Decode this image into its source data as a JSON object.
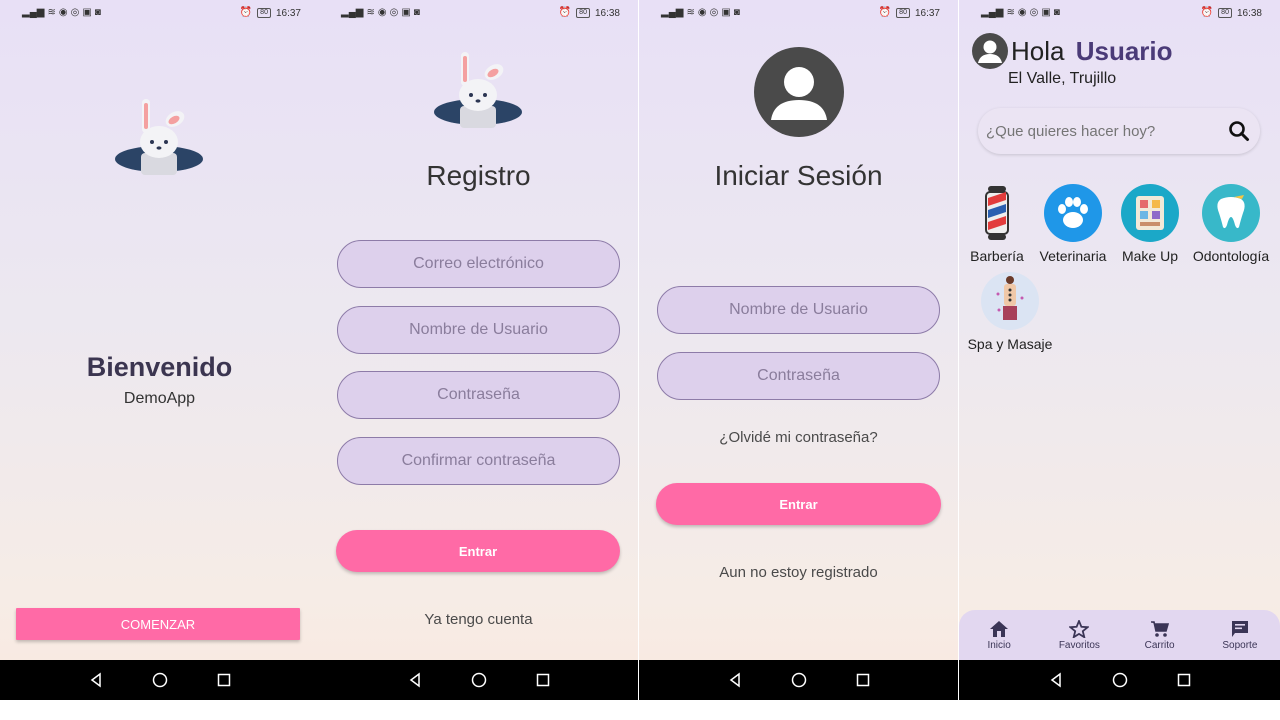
{
  "screens": {
    "welcome": {
      "time": "16:37",
      "battery": "80",
      "title": "Bienvenido",
      "subtitle": "DemoApp",
      "start_button": "COMENZAR"
    },
    "register": {
      "time": "16:38",
      "battery": "80",
      "title": "Registro",
      "email_placeholder": "Correo electrónico",
      "username_placeholder": "Nombre de Usuario",
      "password_placeholder": "Contraseña",
      "confirm_placeholder": "Confirmar contraseña",
      "submit_button": "Entrar",
      "have_account_link": "Ya tengo cuenta"
    },
    "login": {
      "time": "16:37",
      "battery": "80",
      "title": "Iniciar Sesión",
      "username_placeholder": "Nombre de Usuario",
      "password_placeholder": "Contraseña",
      "forgot_link": "¿Olvidé mi contraseña?",
      "submit_button": "Entrar",
      "not_registered_link": "Aun no estoy registrado"
    },
    "home": {
      "time": "16:38",
      "battery": "80",
      "greeting": "Hola",
      "user_name": "Usuario",
      "location": "El Valle, Trujillo",
      "search_placeholder": "¿Que quieres hacer hoy?",
      "categories": [
        {
          "label": "Barbería",
          "icon": "barber-pole-icon"
        },
        {
          "label": "Veterinaria",
          "icon": "paw-icon"
        },
        {
          "label": "Make Up",
          "icon": "makeup-palette-icon"
        },
        {
          "label": "Odontología",
          "icon": "tooth-icon"
        },
        {
          "label": "Spa y Masaje",
          "icon": "spa-massage-icon"
        }
      ],
      "bottom_nav": [
        {
          "label": "Inicio",
          "icon": "home-icon"
        },
        {
          "label": "Favoritos",
          "icon": "star-icon"
        },
        {
          "label": "Carrito",
          "icon": "cart-icon"
        },
        {
          "label": "Soporte",
          "icon": "chat-icon"
        }
      ]
    }
  },
  "colors": {
    "accent_pink": "#ff6aa6",
    "field_fill": "#ddd0ec",
    "field_border": "#8d7ba8",
    "username_purple": "#4b3b78",
    "nav_bar": "#000000"
  }
}
